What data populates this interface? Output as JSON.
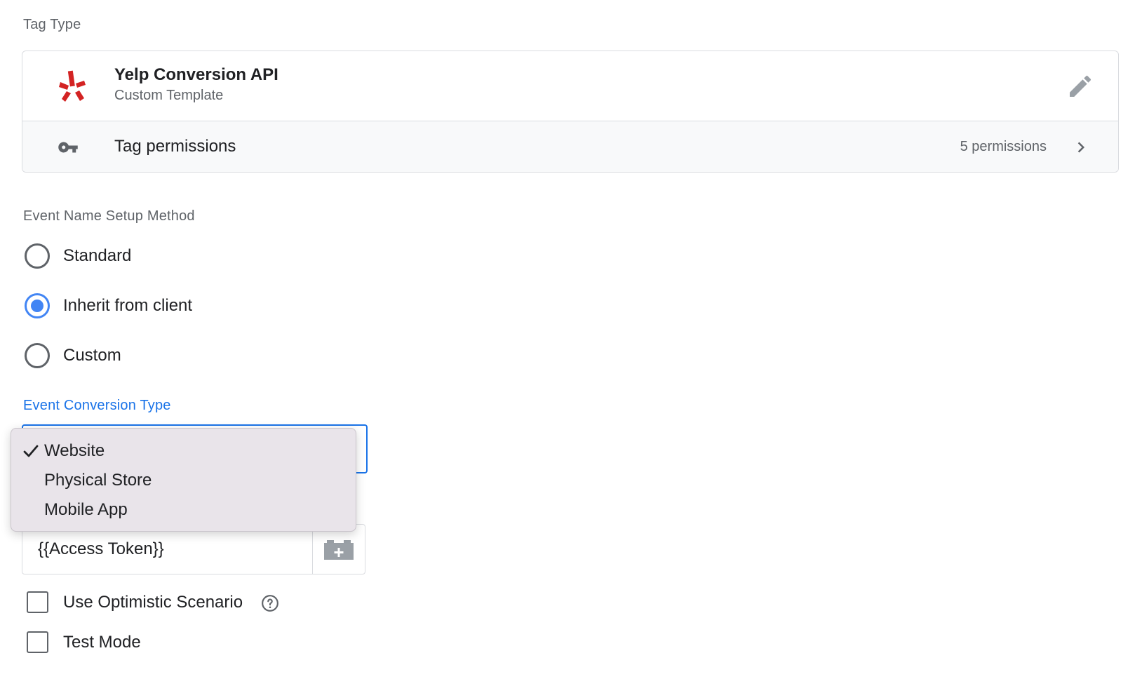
{
  "tag_type": {
    "section_label": "Tag Type",
    "title": "Yelp Conversion API",
    "subtitle": "Custom Template",
    "logo_icon": "yelp-logo",
    "edit_icon": "pencil-icon",
    "permissions_label": "Tag permissions",
    "permissions_count": "5 permissions",
    "brand_color": "#d32323"
  },
  "event_name": {
    "section_label": "Event Name Setup Method",
    "options": [
      {
        "label": "Standard",
        "checked": false
      },
      {
        "label": "Inherit from client",
        "checked": true
      },
      {
        "label": "Custom",
        "checked": false
      }
    ]
  },
  "conversion_type": {
    "section_label": "Event Conversion Type",
    "selected": "Website",
    "options": [
      "Website",
      "Physical Store",
      "Mobile App"
    ]
  },
  "access_token": {
    "value": "{{Access Token}}"
  },
  "checkboxes": [
    {
      "label": "Use Optimistic Scenario",
      "checked": false,
      "has_help": true
    },
    {
      "label": "Test Mode",
      "checked": false,
      "has_help": false
    }
  ],
  "colors": {
    "accent": "#1a73e8",
    "radio_checked": "#4285f4"
  }
}
